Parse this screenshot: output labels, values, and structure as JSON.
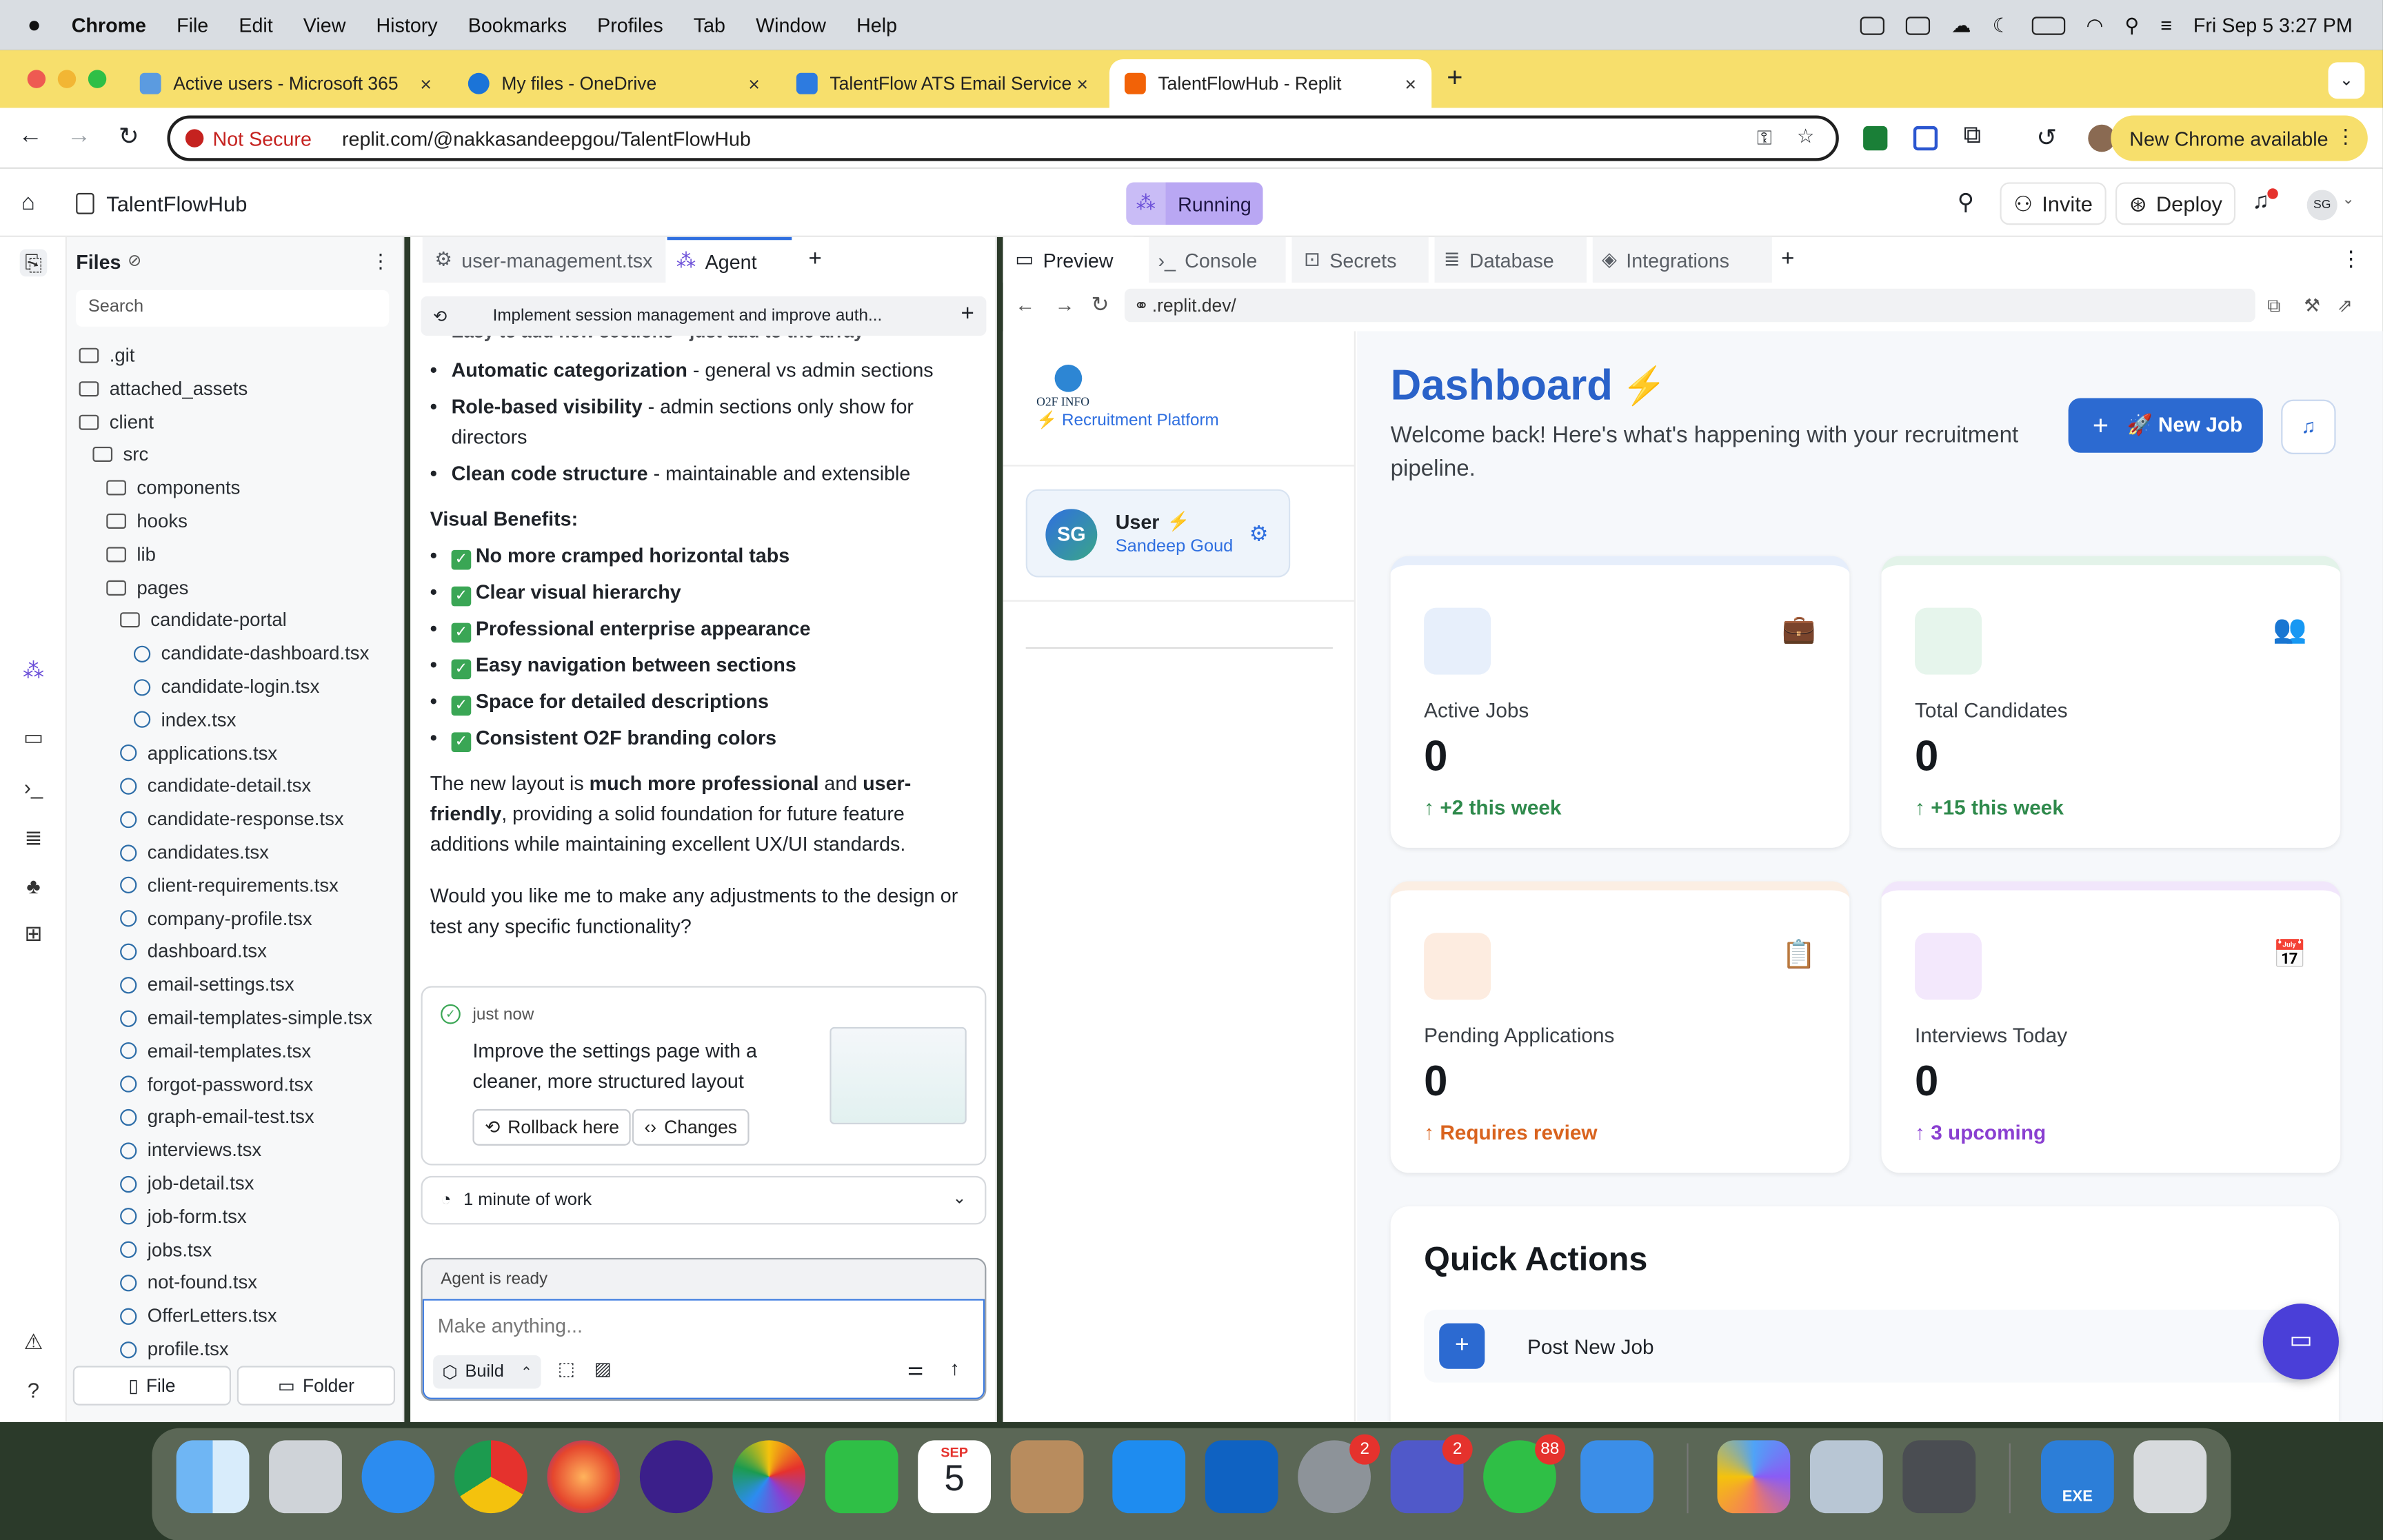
{
  "menubar": {
    "app": "Chrome",
    "items": [
      "File",
      "Edit",
      "View",
      "History",
      "Bookmarks",
      "Profiles",
      "Tab",
      "Window",
      "Help"
    ],
    "datetime": "Fri Sep 5  3:27 PM"
  },
  "tabs": [
    {
      "title": "Active users - Microsoft 365",
      "active": false
    },
    {
      "title": "My files - OneDrive",
      "active": false
    },
    {
      "title": "TalentFlow ATS Email Service",
      "active": false
    },
    {
      "title": "TalentFlowHub - Replit",
      "active": true
    }
  ],
  "address": {
    "security": "Not Secure",
    "url": "replit.com/@nakkasandeepgou/TalentFlowHub",
    "update": "New Chrome available"
  },
  "replit": {
    "project": "TalentFlowHub",
    "status": "Running",
    "invite": "Invite",
    "deploy": "Deploy",
    "avatar": "SG"
  },
  "files": {
    "title": "Files",
    "search_placeholder": "Search",
    "new_file": "File",
    "new_folder": "Folder",
    "items": [
      {
        "name": ".git",
        "type": "folder",
        "indent": 0
      },
      {
        "name": "attached_assets",
        "type": "folder",
        "indent": 0
      },
      {
        "name": "client",
        "type": "folder-open",
        "indent": 0
      },
      {
        "name": "src",
        "type": "folder-open",
        "indent": 1
      },
      {
        "name": "components",
        "type": "folder",
        "indent": 2
      },
      {
        "name": "hooks",
        "type": "folder",
        "indent": 2
      },
      {
        "name": "lib",
        "type": "folder",
        "indent": 2
      },
      {
        "name": "pages",
        "type": "folder-open",
        "indent": 2
      },
      {
        "name": "candidate-portal",
        "type": "folder-open",
        "indent": 3
      },
      {
        "name": "candidate-dashboard.tsx",
        "type": "file",
        "indent": 4
      },
      {
        "name": "candidate-login.tsx",
        "type": "file",
        "indent": 4
      },
      {
        "name": "index.tsx",
        "type": "file",
        "indent": 4
      },
      {
        "name": "applications.tsx",
        "type": "file",
        "indent": 3
      },
      {
        "name": "candidate-detail.tsx",
        "type": "file",
        "indent": 3
      },
      {
        "name": "candidate-response.tsx",
        "type": "file",
        "indent": 3
      },
      {
        "name": "candidates.tsx",
        "type": "file",
        "indent": 3
      },
      {
        "name": "client-requirements.tsx",
        "type": "file",
        "indent": 3
      },
      {
        "name": "company-profile.tsx",
        "type": "file",
        "indent": 3
      },
      {
        "name": "dashboard.tsx",
        "type": "file",
        "indent": 3
      },
      {
        "name": "email-settings.tsx",
        "type": "file",
        "indent": 3
      },
      {
        "name": "email-templates-simple.tsx",
        "type": "file",
        "indent": 3
      },
      {
        "name": "email-templates.tsx",
        "type": "file",
        "indent": 3
      },
      {
        "name": "forgot-password.tsx",
        "type": "file",
        "indent": 3
      },
      {
        "name": "graph-email-test.tsx",
        "type": "file",
        "indent": 3
      },
      {
        "name": "interviews.tsx",
        "type": "file",
        "indent": 3
      },
      {
        "name": "job-detail.tsx",
        "type": "file",
        "indent": 3
      },
      {
        "name": "job-form.tsx",
        "type": "file",
        "indent": 3
      },
      {
        "name": "jobs.tsx",
        "type": "file",
        "indent": 3
      },
      {
        "name": "not-found.tsx",
        "type": "file",
        "indent": 3
      },
      {
        "name": "OfferLetters.tsx",
        "type": "file",
        "indent": 3
      },
      {
        "name": "profile.tsx",
        "type": "file",
        "indent": 3
      }
    ]
  },
  "agent": {
    "tab_file": "user-management.tsx",
    "tab_agent": "Agent",
    "thread_title": "Implement session management and improve auth...",
    "cut_line": "Easy to add new sections - just add to the array",
    "bullets1": [
      {
        "b": "Automatic categorization",
        "t": " - general vs admin sections"
      },
      {
        "b": "Role-based visibility",
        "t": " - admin sections only show for directors"
      },
      {
        "b": "Clean code structure",
        "t": " - maintainable and extensible"
      }
    ],
    "visual_title": "Visual Benefits:",
    "bullets2": [
      "No more cramped horizontal tabs",
      "Clear visual hierarchy",
      "Professional enterprise appearance",
      "Easy navigation between sections",
      "Space for detailed descriptions",
      "Consistent O2F branding colors"
    ],
    "para1_a": "The new layout is ",
    "para1_b": "much more professional",
    "para1_c": " and ",
    "para1_d": "user-friendly",
    "para1_e": ", providing a solid foundation for future feature additions while maintaining excellent UX/UI standards.",
    "para2": "Would you like me to make any adjustments to the design or test any specific functionality?",
    "checkpoint": {
      "time": "just now",
      "text": "Improve the settings page with a cleaner, more structured layout",
      "rollback": "Rollback here",
      "changes": "Changes"
    },
    "work": "1 minute of work",
    "ready": "Agent is ready",
    "input_placeholder": "Make anything...",
    "mode": "Build"
  },
  "preview": {
    "tabs": [
      "Preview",
      "Console",
      "Secrets",
      "Database",
      "Integrations"
    ],
    "url": ".replit.dev/",
    "brand": "O2F INFO",
    "platform": "⚡ Recruitment Platform",
    "user": {
      "initials": "SG",
      "name": "User",
      "bolt": "⚡",
      "sub": "Sandeep Goud"
    },
    "title": "Dashboard",
    "title_icon": "⚡",
    "welcome": "Welcome back! Here's what's happening with your recruitment pipeline.",
    "new_job": "🚀 New Job",
    "stats": [
      {
        "label": "Active Jobs",
        "value": "0",
        "sub": "+2 this week",
        "color": "#2f8a4c",
        "emoji": "💼",
        "accent": "#3b78d8"
      },
      {
        "label": "Total Candidates",
        "value": "0",
        "sub": "+15 this week",
        "color": "#2f8a4c",
        "emoji": "👥",
        "accent": "#3aa466"
      },
      {
        "label": "Pending Applications",
        "value": "0",
        "sub": "Requires review",
        "color": "#d9631e",
        "emoji": "📋",
        "accent": "#e07a3a"
      },
      {
        "label": "Interviews Today",
        "value": "0",
        "sub": "3 upcoming",
        "color": "#8a3fd1",
        "emoji": "📅",
        "accent": "#9b4fe0"
      }
    ],
    "quick_title": "Quick Actions",
    "quick_first": "Post New Job"
  },
  "dock": {
    "calendar_month": "SEP",
    "calendar_day": "5",
    "badges": {
      "settings": "2",
      "teams": "2",
      "whatsapp": "88"
    },
    "exe": "EXE"
  },
  "colors": {
    "tabstrip": "#f7df6c",
    "accent": "#2f6fe0",
    "running": "#b9a7f3"
  }
}
